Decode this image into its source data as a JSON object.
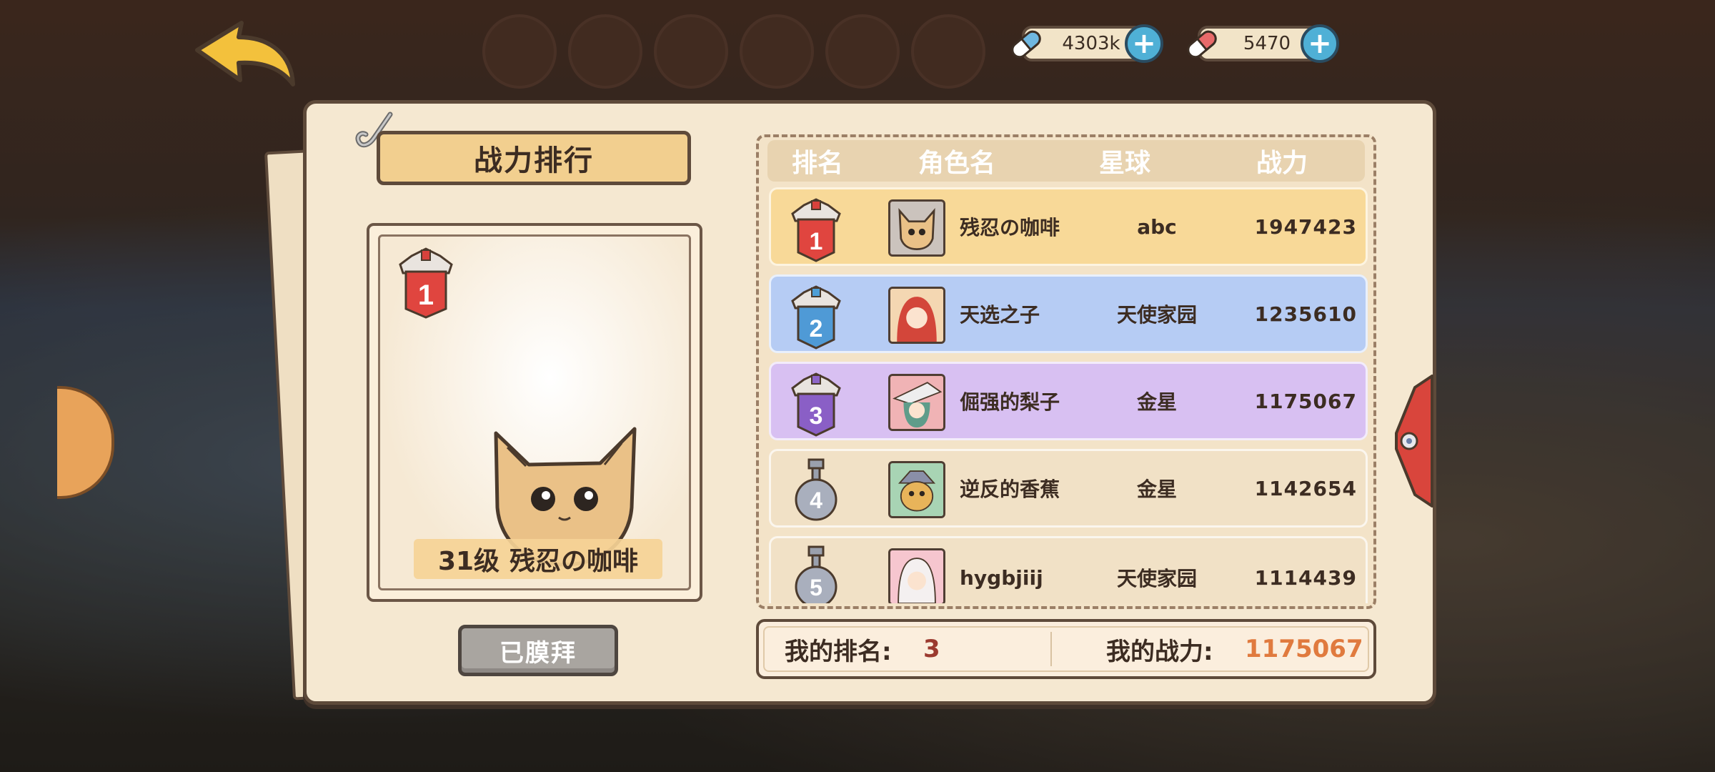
{
  "currencies": [
    {
      "value": "4303k",
      "icon": "blue-pill-icon",
      "add_icon": "plus-icon"
    },
    {
      "value": "5470",
      "icon": "red-pill-icon",
      "add_icon": "plus-icon"
    }
  ],
  "panel": {
    "title": "战力排行",
    "preview": {
      "level": "31级",
      "name": "残忍の咖啡",
      "rank_badge": "1"
    },
    "worship_button": "已膜拜"
  },
  "list": {
    "headers": [
      "排名",
      "角色名",
      "星球",
      "战力"
    ],
    "rows": [
      {
        "rank": "1",
        "name": "残忍の咖啡",
        "planet": "abc",
        "power": "1947423"
      },
      {
        "rank": "2",
        "name": "天选之子",
        "planet": "天使家园",
        "power": "1235610"
      },
      {
        "rank": "3",
        "name": "倔强的梨子",
        "planet": "金星",
        "power": "1175067"
      },
      {
        "rank": "4",
        "name": "逆反的香蕉",
        "planet": "金星",
        "power": "1142654"
      },
      {
        "rank": "5",
        "name": "hygbjiij",
        "planet": "天使家园",
        "power": "1114439"
      }
    ]
  },
  "my_info": {
    "rank_label": "我的排名:",
    "rank_value": "3",
    "power_label": "我的战力:",
    "power_value": "1175067"
  },
  "colors": {
    "row1": "#f8d998",
    "row2": "#b6ccf4",
    "row3": "#d8c0f2",
    "row_other": "#f1e1c6",
    "highlight": "#e07a3e",
    "rank_value": "#9b3a2f"
  }
}
